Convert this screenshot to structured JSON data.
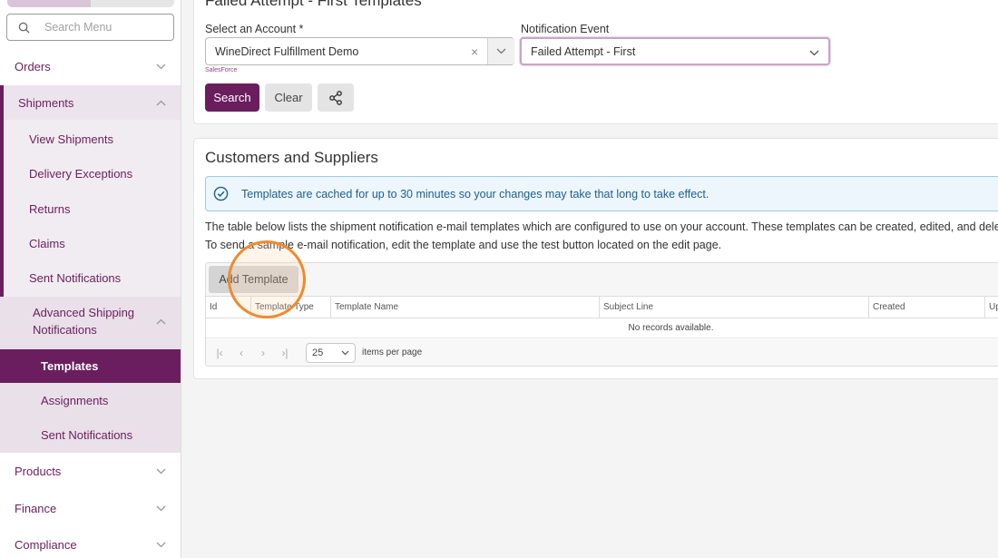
{
  "sidebar": {
    "search_placeholder": "Search Menu",
    "items": {
      "orders": "Orders",
      "shipments": "Shipments",
      "view_shipments": "View Shipments",
      "delivery_exceptions": "Delivery Exceptions",
      "returns": "Returns",
      "claims": "Claims",
      "sent_notifications": "Sent Notifications",
      "asn_line1": "Advanced Shipping",
      "asn_line2": "Notifications",
      "templates": "Templates",
      "assignments": "Assignments",
      "asn_sent_notifications": "Sent Notifications",
      "products": "Products",
      "finance": "Finance",
      "compliance": "Compliance"
    }
  },
  "filter": {
    "heading": "Failed Attempt - First Templates",
    "account_label": "Select an Account *",
    "account_value": "WineDirect Fulfillment Demo",
    "account_hint": "SalesForce",
    "event_label": "Notification Event",
    "event_value": "Failed Attempt - First",
    "search_label": "Search",
    "clear_label": "Clear"
  },
  "section": {
    "title": "Customers and Suppliers",
    "alert": "Templates are cached for up to 30 minutes so your changes may take that long to take effect.",
    "desc_line1": "The table below lists the shipment notification e-mail templates which are configured to use on your account. These templates can be created, edited, and deleted.",
    "desc_line2": "To send a sample e-mail notification, edit the template and use the test button located on the edit page."
  },
  "grid": {
    "add_label": "Add Template",
    "columns": [
      "Id",
      "Template Type",
      "Template Name",
      "Subject Line",
      "Created",
      "Updated"
    ],
    "empty": "No records available.",
    "page_size": "25",
    "items_per_page": "items per page"
  },
  "colors": {
    "brand": "#6b1e5e",
    "highlight_ring": "#ef8a2e",
    "alert_text": "#1d5f8c"
  }
}
